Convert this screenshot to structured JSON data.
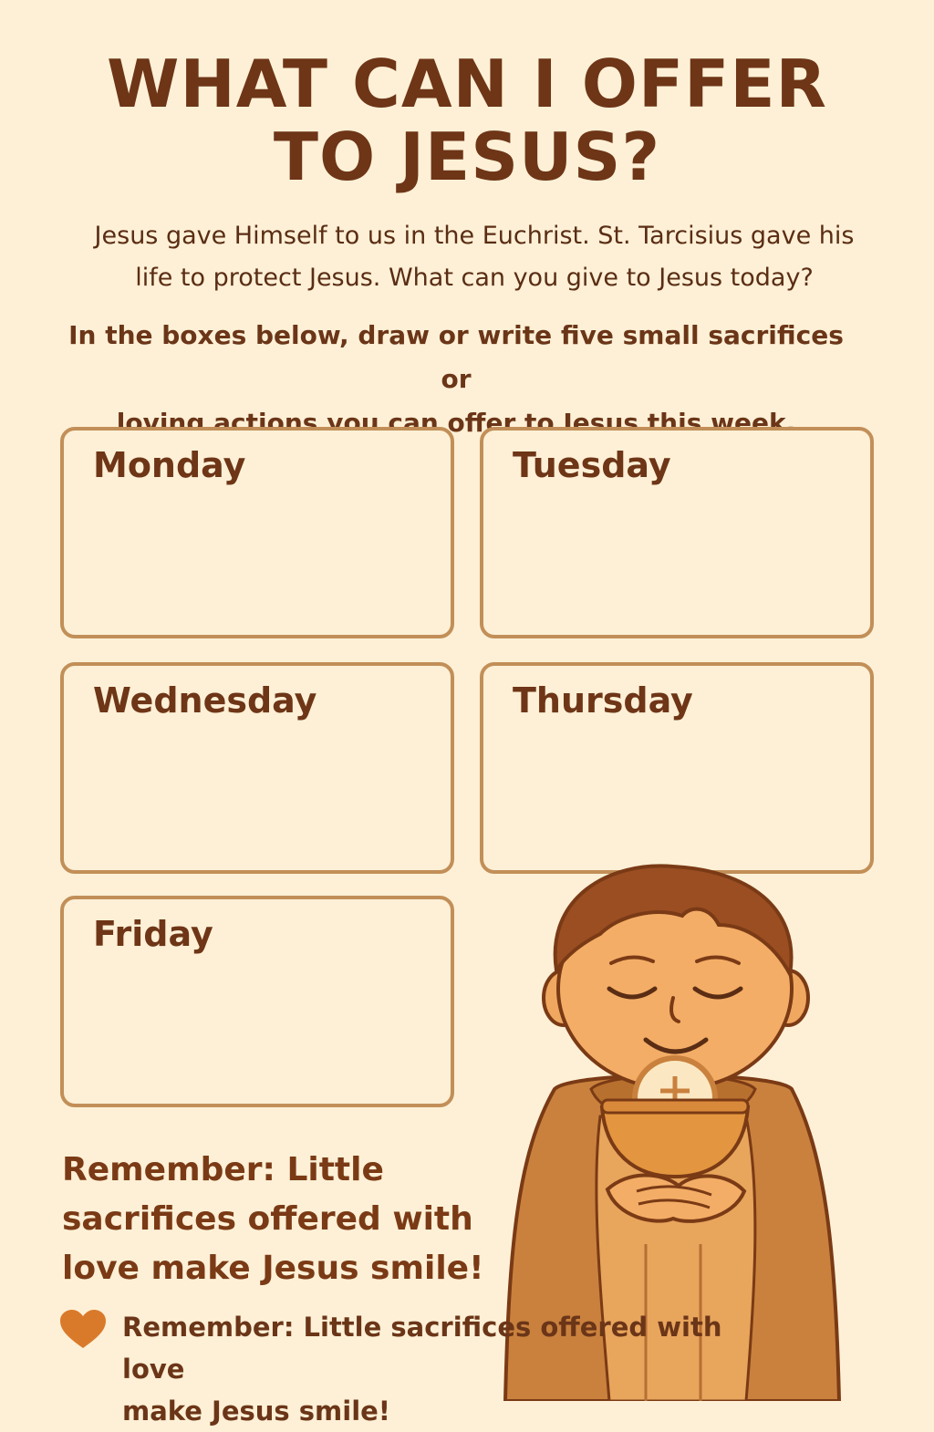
{
  "header": {
    "title_line1": "WHAT CAN I OFFER",
    "title_line2": "TO JESUS?"
  },
  "intro": {
    "line1": "Jesus gave Himself to us in the Euchrist. St. Tarcisius gave his",
    "line2": "life to protect Jesus. What can you give to Jesus today?"
  },
  "instructions": {
    "line1": "In the boxes below, draw or write five small sacrifices or",
    "line2": "loving actions you can offer to Jesus this week."
  },
  "days": [
    {
      "label": "Monday"
    },
    {
      "label": "Tuesday"
    },
    {
      "label": "Wednesday"
    },
    {
      "label": "Thursday"
    },
    {
      "label": "Friday"
    }
  ],
  "remember": {
    "line1": "Remember: Little",
    "line2": "sacrifices offered with",
    "line3": "love make Jesus smile!"
  },
  "footer": {
    "icon": "heart-icon",
    "line1": "Remember: Little sacrifices offered with love",
    "line2": "make Jesus smile!"
  },
  "colors": {
    "background": "#fdf0d6",
    "text_brown": "#6e3517",
    "box_border": "#c28f58",
    "heart": "#d97a2b"
  }
}
